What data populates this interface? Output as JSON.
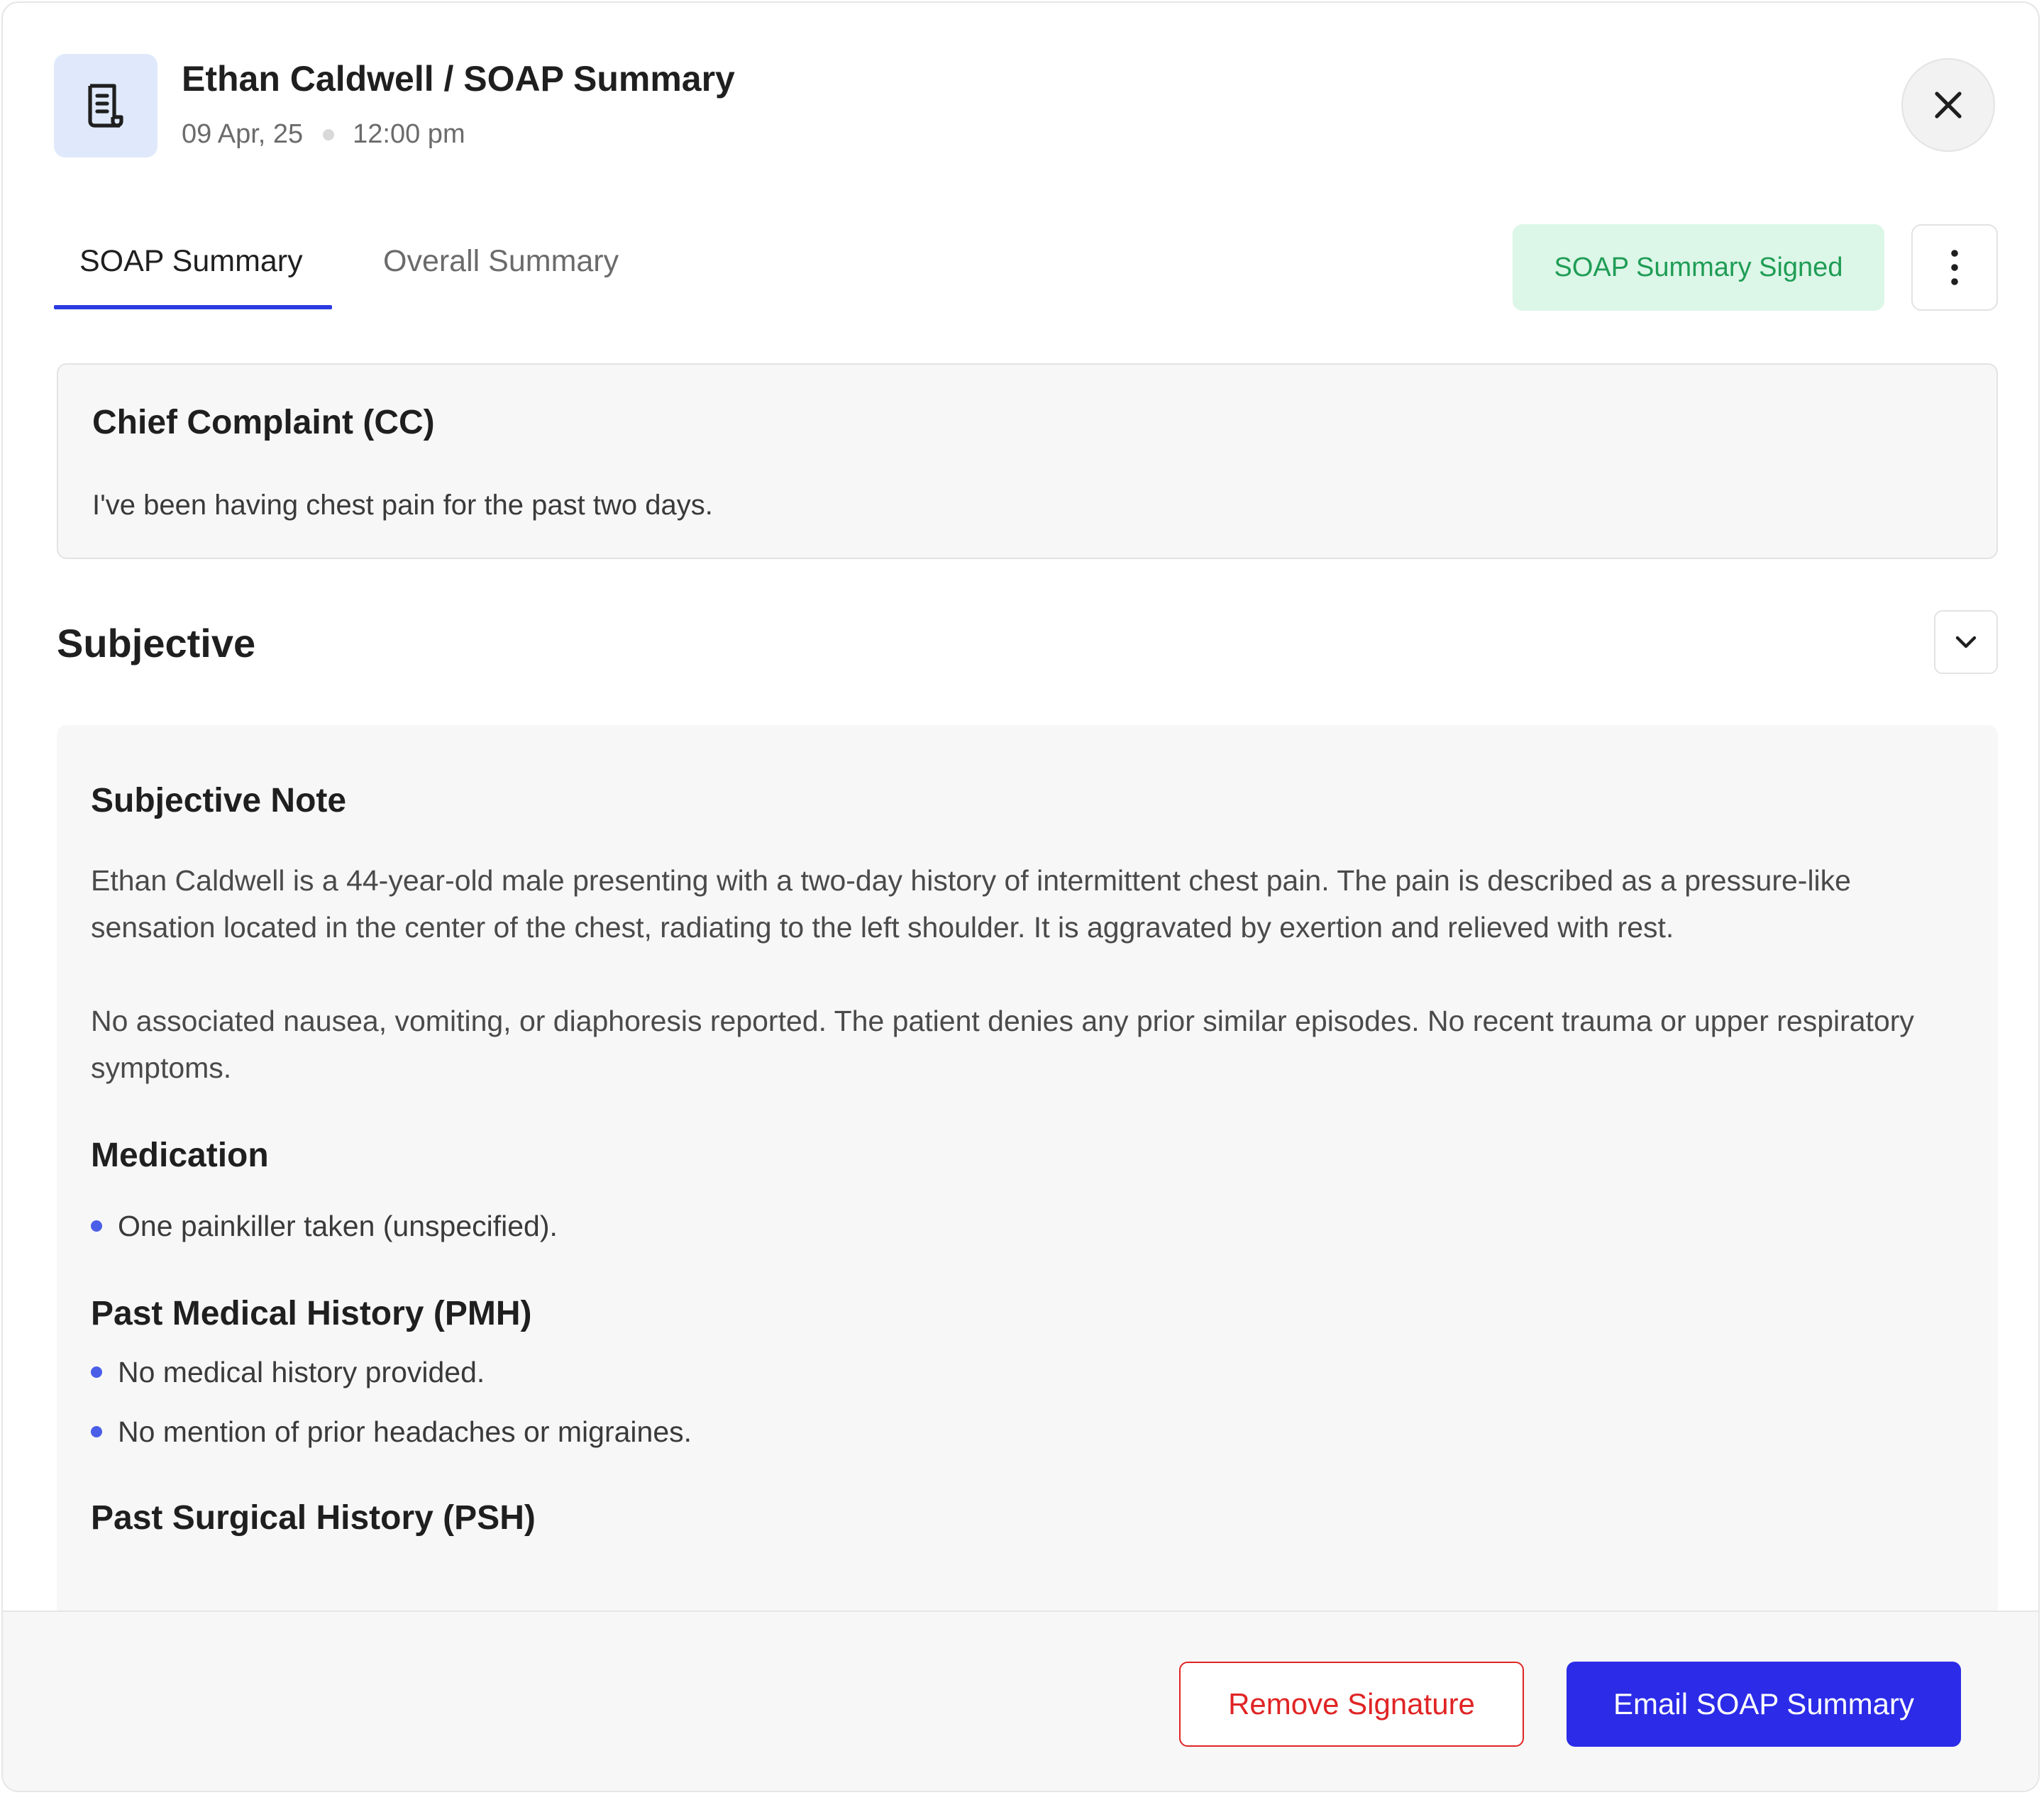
{
  "header": {
    "patient": "Ethan Caldwell",
    "separator": " / ",
    "doc_title": "SOAP Summary",
    "title": "Ethan Caldwell / SOAP Summary",
    "date": "09 Apr, 25",
    "time": "12:00 pm",
    "icon": "document-icon",
    "close_icon": "close-icon"
  },
  "tabs": [
    {
      "label": "SOAP Summary",
      "active": true
    },
    {
      "label": "Overall Summary",
      "active": false
    }
  ],
  "status_badge": "SOAP Summary Signed",
  "more_icon": "more-vertical-icon",
  "chief_complaint": {
    "title": "Chief Complaint (CC)",
    "text": "I've been having chest pain for the past two days."
  },
  "subjective": {
    "section_title": "Subjective",
    "toggle_icon": "chevron-down-icon",
    "note_title": "Subjective Note",
    "note_paragraphs": [
      "Ethan Caldwell is a 44-year-old male presenting with a two-day history of intermittent chest pain. The pain is described as a pressure-like sensation located in the center of the chest, radiating to the left shoulder. It is aggravated by exertion and relieved with rest.",
      "No associated nausea, vomiting, or diaphoresis reported. The patient denies any prior similar episodes. No recent trauma or upper respiratory symptoms."
    ],
    "medication_title": "Medication",
    "medication_items": [
      "One painkiller taken (unspecified)."
    ],
    "pmh_title": "Past Medical History (PMH)",
    "pmh_items": [
      "No medical history provided.",
      "No mention of prior headaches or migraines."
    ],
    "next_title_partial": "Past Surgical History (PSH)"
  },
  "footer": {
    "remove_label": "Remove Signature",
    "email_label": "Email SOAP Summary"
  },
  "colors": {
    "accent": "#2b2be8",
    "tab_underline": "#2b3be0",
    "signed_bg": "#dcf6e8",
    "signed_text": "#1f9d55",
    "danger": "#e02424",
    "bullet": "#4a5ee8"
  }
}
